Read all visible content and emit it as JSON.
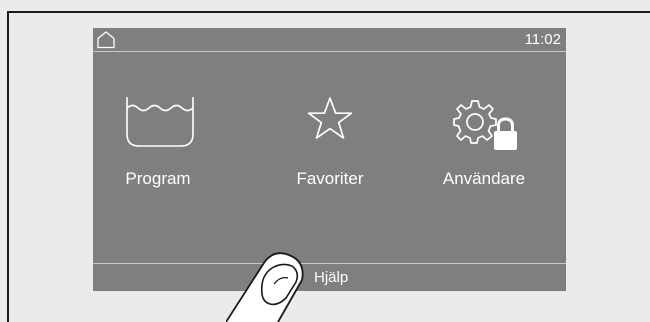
{
  "status": {
    "home_icon": "home-icon",
    "time": "11:02"
  },
  "menu": {
    "items": [
      {
        "label": "Program",
        "icon": "wash-tub-icon"
      },
      {
        "label": "Favoriter",
        "icon": "star-icon"
      },
      {
        "label": "Användare",
        "icon": "gear-lock-icon"
      }
    ]
  },
  "bottom": {
    "help_label": "Hjälp"
  },
  "colors": {
    "screen": "#7e7f81",
    "background": "#ebebeb",
    "text": "#ffffff"
  }
}
